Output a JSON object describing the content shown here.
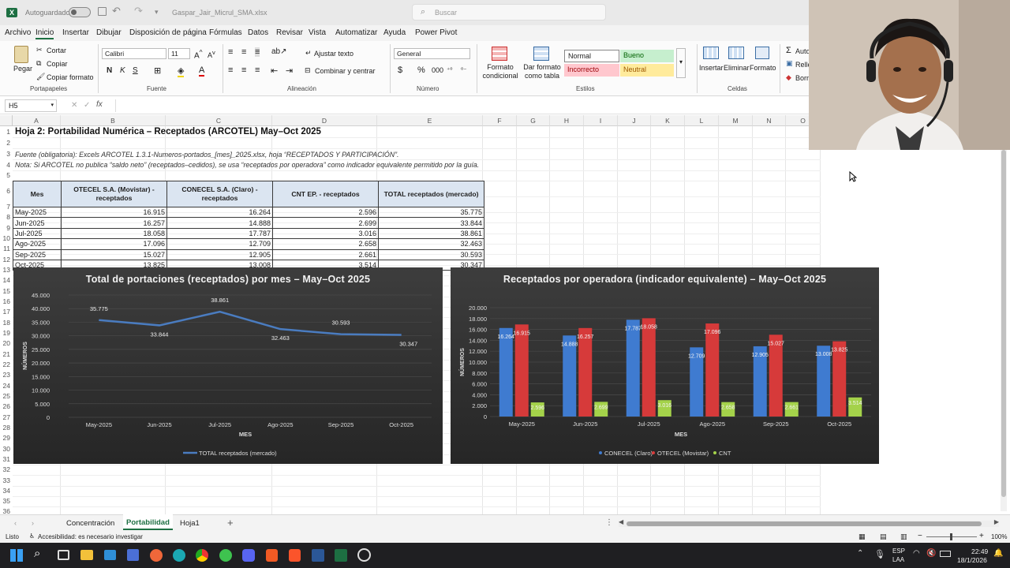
{
  "titlebar": {
    "autosave": "Autoguardado",
    "filename": "Gaspar_Jair_Micrul_SMA.xlsx",
    "search_placeholder": "Buscar"
  },
  "menu": [
    "Archivo",
    "Inicio",
    "Insertar",
    "Dibujar",
    "Disposición de página",
    "Fórmulas",
    "Datos",
    "Revisar",
    "Vista",
    "Automatizar",
    "Ayuda",
    "Power Pivot"
  ],
  "ribbon": {
    "paste": "Pegar",
    "cut": "Cortar",
    "copy": "Copiar",
    "format_painter": "Copiar formato",
    "group_clipboard": "Portapapeles",
    "font_name": "Calibri",
    "font_size": "11",
    "group_font": "Fuente",
    "wrap": "Ajustar texto",
    "merge": "Combinar y centrar",
    "group_align": "Alineación",
    "number_format": "General",
    "group_number": "Número",
    "cond_format": "Formato condicional",
    "table_format": "Dar formato como tabla",
    "style_normal": "Normal",
    "style_good": "Bueno",
    "style_bad": "Incorrecto",
    "style_neutral": "Neutral",
    "group_styles": "Estilos",
    "insert": "Insertar",
    "delete": "Eliminar",
    "format": "Formato",
    "group_cells": "Celdas",
    "autosum": "Auto",
    "fill": "Relle",
    "clear": "Borr"
  },
  "formula": {
    "namebox": "H5",
    "fx": "fx",
    "content": ""
  },
  "columns": [
    "A",
    "B",
    "C",
    "D",
    "E",
    "F",
    "G",
    "H",
    "I",
    "J",
    "K",
    "L",
    "M",
    "N",
    "O"
  ],
  "rows": [
    "1",
    "2",
    "3",
    "4",
    "5",
    "6",
    "7",
    "8",
    "9",
    "10",
    "11",
    "12",
    "13",
    "14",
    "15",
    "16",
    "17",
    "18",
    "19",
    "20",
    "21",
    "22",
    "23",
    "24",
    "25",
    "26",
    "27",
    "28",
    "29",
    "30",
    "31",
    "32",
    "33",
    "34",
    "35",
    "36"
  ],
  "sheet": {
    "title": "Hoja 2: Portabilidad Numérica – Receptados (ARCOTEL) May–Oct 2025",
    "source": "Fuente (obligatoria): Excels ARCOTEL 1.3.1-Numeros-portados_[mes]_2025.xlsx, hoja “RECEPTADOS Y PARTICIPACIÓN”.",
    "note": "Nota: Si ARCOTEL no publica “saldo neto” (receptados–cedidos), se usa “receptados por operadora” como indicador equivalente permitido por la guía.",
    "headers": [
      "Mes",
      "OTECEL S.A. (Movistar) - receptados",
      "CONECEL S.A. (Claro) - receptados",
      "CNT EP. - receptados",
      "TOTAL receptados (mercado)"
    ],
    "table": [
      [
        "May-2025",
        "16.915",
        "16.264",
        "2.596",
        "35.775"
      ],
      [
        "Jun-2025",
        "16.257",
        "14.888",
        "2.699",
        "33.844"
      ],
      [
        "Jul-2025",
        "18.058",
        "17.787",
        "3.016",
        "38.861"
      ],
      [
        "Ago-2025",
        "17.096",
        "12.709",
        "2.658",
        "32.463"
      ],
      [
        "Sep-2025",
        "15.027",
        "12.905",
        "2.661",
        "30.593"
      ],
      [
        "Oct-2025",
        "13.825",
        "13.008",
        "3.514",
        "30.347"
      ]
    ]
  },
  "chart_data": [
    {
      "type": "line",
      "title": "Total de portaciones (receptados) por mes – May–Oct 2025",
      "xlabel": "MES",
      "ylabel": "NÚMEROS",
      "categories": [
        "May-2025",
        "Jun-2025",
        "Jul-2025",
        "Ago-2025",
        "Sep-2025",
        "Oct-2025"
      ],
      "series": [
        {
          "name": "TOTAL receptados (mercado)",
          "values": [
            35775,
            33844,
            38861,
            32463,
            30593,
            30347
          ],
          "labels": [
            "35.775",
            "33.844",
            "38.861",
            "32.463",
            "30.593",
            "30.347"
          ],
          "color": "#4a7cc0"
        }
      ],
      "ylim": [
        0,
        45000
      ],
      "yticks": [
        "0",
        "5.000",
        "10.000",
        "15.000",
        "20.000",
        "25.000",
        "30.000",
        "35.000",
        "40.000",
        "45.000"
      ],
      "grid": true,
      "legend": "bottom"
    },
    {
      "type": "bar",
      "title": "Receptados por operadora (indicador equivalente) – May–Oct 2025",
      "xlabel": "MES",
      "ylabel": "NÚMEROS",
      "categories": [
        "May-2025",
        "Jun-2025",
        "Jul-2025",
        "Ago-2025",
        "Sep-2025",
        "Oct-2025"
      ],
      "series": [
        {
          "name": "CONECEL (Claro)",
          "values": [
            16264,
            14888,
            17787,
            12709,
            12905,
            13008
          ],
          "labels": [
            "16.264",
            "14.888",
            "17.787",
            "12.709",
            "12.905",
            "13.008"
          ],
          "color": "#3f7bd0"
        },
        {
          "name": "OTECEL (Movistar)",
          "values": [
            16915,
            16257,
            18058,
            17096,
            15027,
            13825
          ],
          "labels": [
            "16.915",
            "16.257",
            "18.058",
            "17.096",
            "15.027",
            "13.825"
          ],
          "color": "#d63a3a"
        },
        {
          "name": "CNT",
          "values": [
            2596,
            2699,
            3016,
            2658,
            2661,
            3514
          ],
          "labels": [
            "2.596",
            "2.699",
            "3.016",
            "2.658",
            "2.661",
            "3.514"
          ],
          "color": "#a4d24a"
        }
      ],
      "ylim": [
        0,
        20000
      ],
      "yticks": [
        "0",
        "2.000",
        "4.000",
        "6.000",
        "8.000",
        "10.000",
        "12.000",
        "14.000",
        "16.000",
        "18.000",
        "20.000"
      ],
      "grid": true,
      "legend": "bottom"
    }
  ],
  "tabs": [
    "Concentración",
    "Portabilidad",
    "Hoja1"
  ],
  "active_tab": "Portabilidad",
  "status": {
    "ready": "Listo",
    "accessibility": "Accesibilidad: es necesario investigar",
    "zoom": "100%"
  },
  "taskbar": {
    "lang1": "ESP",
    "lang2": "LAA",
    "time": "22:49",
    "date": "18/1/2026"
  }
}
